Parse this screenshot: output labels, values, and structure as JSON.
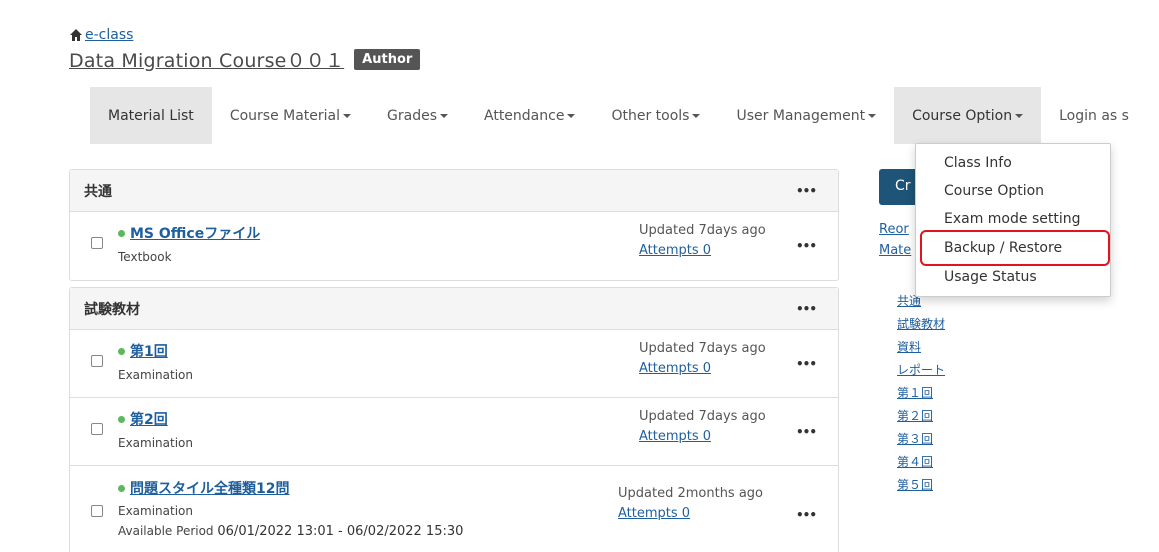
{
  "header": {
    "home_link": "e-class",
    "course_title": "Data Migration Course００１",
    "role_badge": "Author"
  },
  "nav": {
    "items": [
      {
        "label": "Material List",
        "dropdown": false
      },
      {
        "label": "Course Material",
        "dropdown": true
      },
      {
        "label": "Grades",
        "dropdown": true
      },
      {
        "label": "Attendance",
        "dropdown": true
      },
      {
        "label": "Other tools",
        "dropdown": true
      },
      {
        "label": "User Management",
        "dropdown": true
      },
      {
        "label": "Course Option",
        "dropdown": true
      },
      {
        "label": "Login as s",
        "dropdown": false
      }
    ]
  },
  "dropdown": {
    "items": [
      "Class Info",
      "Course Option",
      "Exam mode setting",
      "Backup / Restore",
      "Usage Status"
    ],
    "highlighted": "Backup / Restore"
  },
  "sections": [
    {
      "title": "共通",
      "items": [
        {
          "title": "MS Officeファイル",
          "type": "Textbook",
          "updated": "Updated 7days ago",
          "attempts": "Attempts 0"
        }
      ]
    },
    {
      "title": "試験教材",
      "items": [
        {
          "title": "第1回",
          "type": "Examination",
          "updated": "Updated 7days ago",
          "attempts": "Attempts 0"
        },
        {
          "title": "第2回",
          "type": "Examination",
          "updated": "Updated 7days ago",
          "attempts": "Attempts 0"
        },
        {
          "title": "問題スタイル全種類12問",
          "type": "Examination",
          "updated": "Updated 2months ago",
          "attempts": "Attempts 0",
          "period_label": "Available Period",
          "period_value": "06/01/2022 13:01 - 06/02/2022 15:30"
        }
      ]
    }
  ],
  "sidebar": {
    "create_button": "Cr",
    "reorder_line1": "Reor",
    "reorder_line2": "Mate",
    "section_links": [
      "共通",
      "試験教材",
      "資料",
      "レポート",
      "第１回",
      "第２回",
      "第３回",
      "第４回",
      "第５回"
    ]
  },
  "colors": {
    "link": "#1f5f9e",
    "primary_button": "#1d5477",
    "status_dot": "#5cb85c",
    "highlight_border": "#e0141e"
  }
}
